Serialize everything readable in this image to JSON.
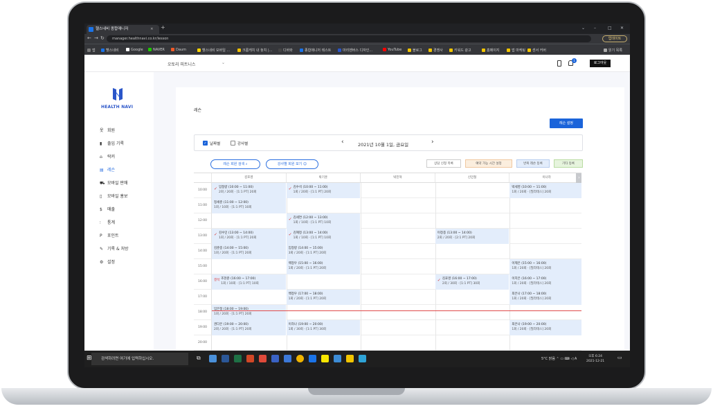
{
  "browser": {
    "tab_title": "헬스네비 종합매니저",
    "url": "manager.healthnavi.co.kr/lesson",
    "update_label": "업데이트",
    "bookmarks": [
      "앱",
      "헬스네비",
      "Google",
      "NAVER",
      "Daum",
      "헬스네비 모바일 ...",
      "크롬캐치 내 놓치 |...",
      "디바와",
      "종합매니저 테스트",
      "마리멘버스 디자인...",
      "YouTube",
      "블로그",
      "경쟁사",
      "키워드 광고",
      "홈페이지",
      "앱 마케팅",
      "센서 커버",
      "읽기 목록"
    ],
    "window_controls": [
      "⌄",
      "–",
      "□",
      "✕"
    ]
  },
  "header": {
    "branch": "오토리 피트니스",
    "badge": "1",
    "logout": "로그아웃"
  },
  "sidebar": {
    "logo": "HEALTH NAVI",
    "items": [
      {
        "icon": "옷",
        "label": "회원"
      },
      {
        "icon": "▮",
        "label": "출입 기록"
      },
      {
        "icon": "⌂",
        "label": "락커"
      },
      {
        "icon": "▤",
        "label": "레슨"
      },
      {
        "icon": "⛟",
        "label": "모바일 판매"
      },
      {
        "icon": "▯",
        "label": "모바일 홍보"
      },
      {
        "icon": "$",
        "label": "매출"
      },
      {
        "icon": "⫶",
        "label": "통계"
      },
      {
        "icon": "P",
        "label": "포인트"
      },
      {
        "icon": "✎",
        "label": "기록 & 처방"
      },
      {
        "icon": "⚙",
        "label": "설정"
      }
    ]
  },
  "panel": {
    "title": "레슨",
    "settings_button": "레슨 설정",
    "filter": {
      "by_date": "날짜별",
      "by_trainer": "강사별",
      "date": "2021년 10월 1일, 금요일",
      "prev": "‹",
      "next": "›"
    },
    "member_search": "레슨 회원 검색",
    "trainer_view": "강사별 회원 보기",
    "tags": [
      "상담 신청 목록",
      "예약 가능 시간 설정",
      "반복 레슨 등록",
      "기타 등록"
    ],
    "trainers": [
      "김포영",
      "박기훈",
      "박진혁",
      "신민철",
      "이나라"
    ],
    "times": [
      "10:00",
      "11:00",
      "12:00",
      "13:00",
      "14:00",
      "15:00",
      "16:00",
      "17:00",
      "18:00",
      "19:00",
      "20:00"
    ],
    "events": [
      {
        "row": 0,
        "col": 0,
        "check": true,
        "name": "임정량 (10:00 ~ 11:00)",
        "sub": "2회 / 20회 · [1:1 PT] 20회"
      },
      {
        "row": 0,
        "col": 1,
        "check": true,
        "name": "김수석 (10:00 ~ 11:00)",
        "sub": "1회 / 20회 · [1:1 PT] 20회"
      },
      {
        "row": 0,
        "col": 4,
        "check": false,
        "name": "박세영 (10:00 ~ 11:00)",
        "sub": "1회 / 20회 · [필라테스] 20회"
      },
      {
        "row": 1,
        "col": 0,
        "check": false,
        "name": "정세준 (11:00 ~ 12:00)",
        "sub": "1회 / 10회 · [1:1 PT] 10회"
      },
      {
        "row": 2,
        "col": 1,
        "check": true,
        "name": "김세연 (12:00 ~ 13:00)",
        "sub": "1회 / 10회 · [1:1 PT] 10회"
      },
      {
        "row": 3,
        "col": 0,
        "check": true,
        "name": "김수민 (13:00 ~ 14:00)",
        "sub": "1회 / 20회 · [1:1 PT] 20회"
      },
      {
        "row": 3,
        "col": 1,
        "check": true,
        "name": "김혜정 (13:00 ~ 14:00)",
        "sub": "1회 / 10회 · [1:1 PT] 10회"
      },
      {
        "row": 3,
        "col": 3,
        "check": false,
        "name": "이정종 (13:00 ~ 14:00)",
        "sub": "2회 / 20회 · [2:1 PT] 20회"
      },
      {
        "row": 4,
        "col": 0,
        "check": false,
        "name": "김준중 (14:00 ~ 15:00)",
        "sub": "1회 / 20회 · [1:1 PT] 20회"
      },
      {
        "row": 4,
        "col": 1,
        "check": false,
        "name": "임정량 (14:00 ~ 15:00)",
        "sub": "3회 / 20회 · [1:1 PT] 20회"
      },
      {
        "row": 5,
        "col": 1,
        "check": false,
        "name": "백정우 (15:00 ~ 16:00)",
        "sub": "1회 / 20회 · [1:1 PT] 20회"
      },
      {
        "row": 5,
        "col": 4,
        "check": false,
        "name": "이제은 (15:00 ~ 16:00)",
        "sub": "1회 / 20회 · [필라테스] 20회"
      },
      {
        "row": 6,
        "col": 0,
        "check": false,
        "mark": "결석",
        "name": "조현준 (16:00 ~ 17:00)",
        "sub": "1회 / 10회 · [1:1 PT] 10회"
      },
      {
        "row": 6,
        "col": 3,
        "check": true,
        "name": "김효영 (16:00 ~ 17:00)",
        "sub": "2회 / 30회 · [1:1 PT] 30회"
      },
      {
        "row": 6,
        "col": 4,
        "check": false,
        "name": "이지은 (16:00 ~ 17:00)",
        "sub": "1회 / 20회 · [필라테스] 20회"
      },
      {
        "row": 7,
        "col": 1,
        "check": false,
        "name": "백정우 (17:00 ~ 18:00)",
        "sub": "1회 / 20회 · [1:1 PT] 20회"
      },
      {
        "row": 7,
        "col": 4,
        "check": false,
        "name": "최은나 (17:00 ~ 18:00)",
        "sub": "1회 / 20회 · [필라테스] 20회"
      },
      {
        "row": 8,
        "col": 0,
        "check": false,
        "name": "임은정 (18:00 ~ 19:00)",
        "sub": "1회 / 20회 · [1:1 PT] 20회"
      },
      {
        "row": 9,
        "col": 0,
        "check": false,
        "name": "권다은 (19:00 ~ 20:00)",
        "sub": "2회 / 20회 · [1:1 PT] 20회"
      },
      {
        "row": 9,
        "col": 1,
        "check": false,
        "name": "이하나 (19:00 ~ 20:00)",
        "sub": "1회 / 30회 · [1:1 PT] 30회"
      },
      {
        "row": 9,
        "col": 4,
        "check": false,
        "name": "최은나 (19:00 ~ 20:00)",
        "sub": "1회 / 20회 · [필라테스] 20회"
      }
    ]
  },
  "taskbar": {
    "search": "검색하려면 여기에 입력하십시오.",
    "weather": "5°C 맑음",
    "time": "오후 6:24",
    "date": "2021-12-21",
    "lang": "A"
  },
  "colors": {
    "accent": "#1b64da",
    "event_bg": "#e3edfb",
    "check": "#d33333"
  }
}
